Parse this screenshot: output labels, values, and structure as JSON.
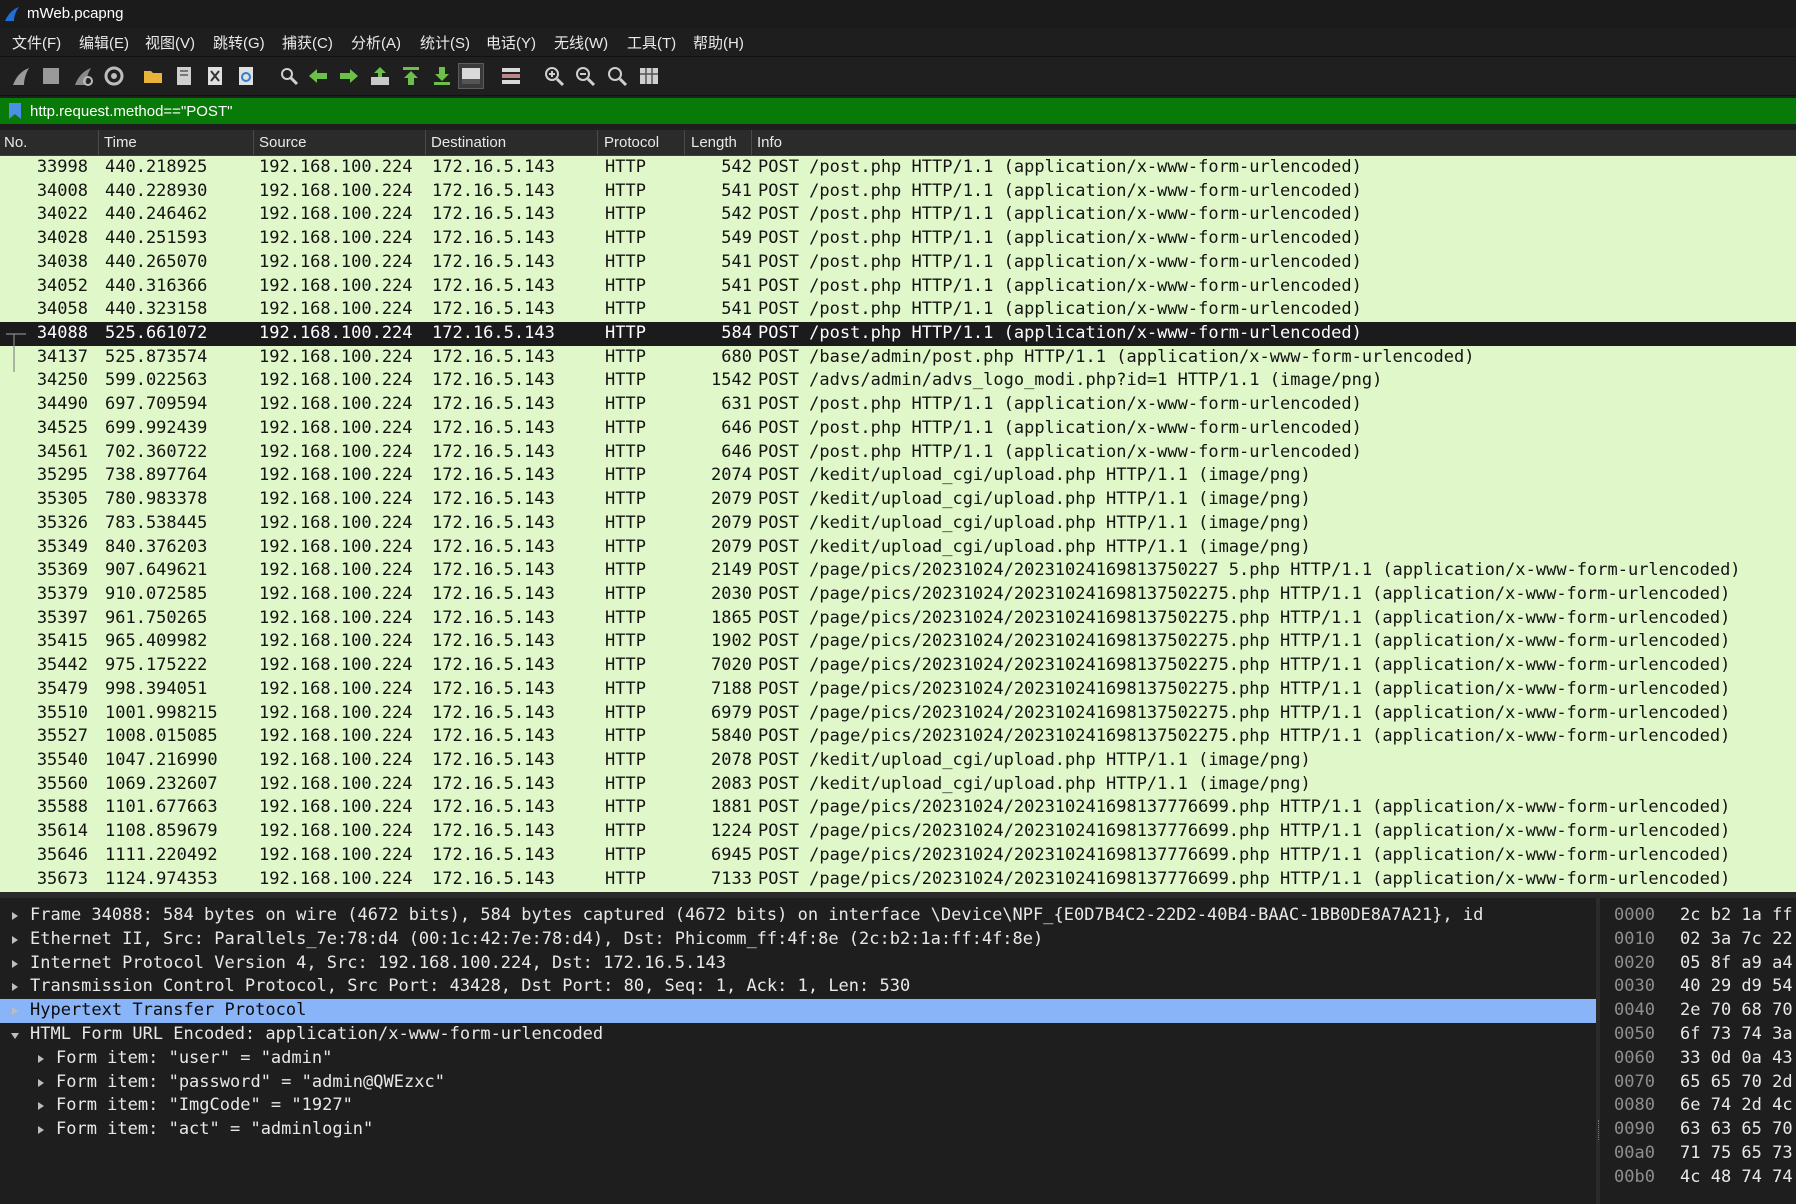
{
  "window": {
    "title": "mWeb.pcapng"
  },
  "menu": [
    "文件(F)",
    "编辑(E)",
    "视图(V)",
    "跳转(G)",
    "捕获(C)",
    "分析(A)",
    "统计(S)",
    "电话(Y)",
    "无线(W)",
    "工具(T)",
    "帮助(H)"
  ],
  "toolbar": [
    {
      "icon": "shark-fin-start-icon"
    },
    {
      "icon": "stop-capture-icon"
    },
    {
      "icon": "restart-capture-icon"
    },
    {
      "icon": "capture-options-icon"
    },
    {
      "icon": "open-folder-icon"
    },
    {
      "icon": "save-file-icon"
    },
    {
      "icon": "close-file-icon"
    },
    {
      "icon": "reload-file-icon"
    },
    {
      "icon": "find-packet-icon"
    },
    {
      "icon": "go-back-icon"
    },
    {
      "icon": "go-forward-icon"
    },
    {
      "icon": "go-to-packet-icon"
    },
    {
      "icon": "go-first-icon"
    },
    {
      "icon": "go-last-icon"
    },
    {
      "icon": "auto-scroll-icon"
    },
    {
      "icon": "colorize-icon"
    },
    {
      "icon": "zoom-in-icon"
    },
    {
      "icon": "zoom-out-icon"
    },
    {
      "icon": "zoom-normal-icon"
    },
    {
      "icon": "resize-columns-icon"
    }
  ],
  "filter": {
    "value": "http.request.method==\"POST\""
  },
  "columns": [
    "No.",
    "Time",
    "Source",
    "Destination",
    "Protocol",
    "Length",
    "Info"
  ],
  "packets": [
    {
      "no": "33998",
      "time": "440.218925",
      "src": "192.168.100.224",
      "dst": "172.16.5.143",
      "proto": "HTTP",
      "len": "542",
      "info": "POST /post.php HTTP/1.1  (application/x-www-form-urlencoded)"
    },
    {
      "no": "34008",
      "time": "440.228930",
      "src": "192.168.100.224",
      "dst": "172.16.5.143",
      "proto": "HTTP",
      "len": "541",
      "info": "POST /post.php HTTP/1.1  (application/x-www-form-urlencoded)"
    },
    {
      "no": "34022",
      "time": "440.246462",
      "src": "192.168.100.224",
      "dst": "172.16.5.143",
      "proto": "HTTP",
      "len": "542",
      "info": "POST /post.php HTTP/1.1  (application/x-www-form-urlencoded)"
    },
    {
      "no": "34028",
      "time": "440.251593",
      "src": "192.168.100.224",
      "dst": "172.16.5.143",
      "proto": "HTTP",
      "len": "549",
      "info": "POST /post.php HTTP/1.1  (application/x-www-form-urlencoded)"
    },
    {
      "no": "34038",
      "time": "440.265070",
      "src": "192.168.100.224",
      "dst": "172.16.5.143",
      "proto": "HTTP",
      "len": "541",
      "info": "POST /post.php HTTP/1.1  (application/x-www-form-urlencoded)"
    },
    {
      "no": "34052",
      "time": "440.316366",
      "src": "192.168.100.224",
      "dst": "172.16.5.143",
      "proto": "HTTP",
      "len": "541",
      "info": "POST /post.php HTTP/1.1  (application/x-www-form-urlencoded)"
    },
    {
      "no": "34058",
      "time": "440.323158",
      "src": "192.168.100.224",
      "dst": "172.16.5.143",
      "proto": "HTTP",
      "len": "541",
      "info": "POST /post.php HTTP/1.1  (application/x-www-form-urlencoded)"
    },
    {
      "no": "34088",
      "time": "525.661072",
      "src": "192.168.100.224",
      "dst": "172.16.5.143",
      "proto": "HTTP",
      "len": "584",
      "info": "POST /post.php HTTP/1.1  (application/x-www-form-urlencoded)",
      "selected": true
    },
    {
      "no": "34137",
      "time": "525.873574",
      "src": "192.168.100.224",
      "dst": "172.16.5.143",
      "proto": "HTTP",
      "len": "680",
      "info": "POST /base/admin/post.php HTTP/1.1  (application/x-www-form-urlencoded)"
    },
    {
      "no": "34250",
      "time": "599.022563",
      "src": "192.168.100.224",
      "dst": "172.16.5.143",
      "proto": "HTTP",
      "len": "1542",
      "info": "POST /advs/admin/advs_logo_modi.php?id=1 HTTP/1.1  (image/png)"
    },
    {
      "no": "34490",
      "time": "697.709594",
      "src": "192.168.100.224",
      "dst": "172.16.5.143",
      "proto": "HTTP",
      "len": "631",
      "info": "POST /post.php HTTP/1.1  (application/x-www-form-urlencoded)"
    },
    {
      "no": "34525",
      "time": "699.992439",
      "src": "192.168.100.224",
      "dst": "172.16.5.143",
      "proto": "HTTP",
      "len": "646",
      "info": "POST /post.php HTTP/1.1  (application/x-www-form-urlencoded)"
    },
    {
      "no": "34561",
      "time": "702.360722",
      "src": "192.168.100.224",
      "dst": "172.16.5.143",
      "proto": "HTTP",
      "len": "646",
      "info": "POST /post.php HTTP/1.1  (application/x-www-form-urlencoded)"
    },
    {
      "no": "35295",
      "time": "738.897764",
      "src": "192.168.100.224",
      "dst": "172.16.5.143",
      "proto": "HTTP",
      "len": "2074",
      "info": "POST /kedit/upload_cgi/upload.php HTTP/1.1  (image/png)"
    },
    {
      "no": "35305",
      "time": "780.983378",
      "src": "192.168.100.224",
      "dst": "172.16.5.143",
      "proto": "HTTP",
      "len": "2079",
      "info": "POST /kedit/upload_cgi/upload.php HTTP/1.1  (image/png)"
    },
    {
      "no": "35326",
      "time": "783.538445",
      "src": "192.168.100.224",
      "dst": "172.16.5.143",
      "proto": "HTTP",
      "len": "2079",
      "info": "POST /kedit/upload_cgi/upload.php HTTP/1.1  (image/png)"
    },
    {
      "no": "35349",
      "time": "840.376203",
      "src": "192.168.100.224",
      "dst": "172.16.5.143",
      "proto": "HTTP",
      "len": "2079",
      "info": "POST /kedit/upload_cgi/upload.php HTTP/1.1  (image/png)"
    },
    {
      "no": "35369",
      "time": "907.649621",
      "src": "192.168.100.224",
      "dst": "172.16.5.143",
      "proto": "HTTP",
      "len": "2149",
      "info": "POST /page/pics/20231024/20231024169813750227 5.php HTTP/1.1  (application/x-www-form-urlencoded)"
    },
    {
      "no": "35379",
      "time": "910.072585",
      "src": "192.168.100.224",
      "dst": "172.16.5.143",
      "proto": "HTTP",
      "len": "2030",
      "info": "POST /page/pics/20231024/202310241698137502275.php HTTP/1.1  (application/x-www-form-urlencoded)"
    },
    {
      "no": "35397",
      "time": "961.750265",
      "src": "192.168.100.224",
      "dst": "172.16.5.143",
      "proto": "HTTP",
      "len": "1865",
      "info": "POST /page/pics/20231024/202310241698137502275.php HTTP/1.1  (application/x-www-form-urlencoded)"
    },
    {
      "no": "35415",
      "time": "965.409982",
      "src": "192.168.100.224",
      "dst": "172.16.5.143",
      "proto": "HTTP",
      "len": "1902",
      "info": "POST /page/pics/20231024/202310241698137502275.php HTTP/1.1  (application/x-www-form-urlencoded)"
    },
    {
      "no": "35442",
      "time": "975.175222",
      "src": "192.168.100.224",
      "dst": "172.16.5.143",
      "proto": "HTTP",
      "len": "7020",
      "info": "POST /page/pics/20231024/202310241698137502275.php HTTP/1.1  (application/x-www-form-urlencoded)"
    },
    {
      "no": "35479",
      "time": "998.394051",
      "src": "192.168.100.224",
      "dst": "172.16.5.143",
      "proto": "HTTP",
      "len": "7188",
      "info": "POST /page/pics/20231024/202310241698137502275.php HTTP/1.1  (application/x-www-form-urlencoded)"
    },
    {
      "no": "35510",
      "time": "1001.998215",
      "src": "192.168.100.224",
      "dst": "172.16.5.143",
      "proto": "HTTP",
      "len": "6979",
      "info": "POST /page/pics/20231024/202310241698137502275.php HTTP/1.1  (application/x-www-form-urlencoded)"
    },
    {
      "no": "35527",
      "time": "1008.015085",
      "src": "192.168.100.224",
      "dst": "172.16.5.143",
      "proto": "HTTP",
      "len": "5840",
      "info": "POST /page/pics/20231024/202310241698137502275.php HTTP/1.1  (application/x-www-form-urlencoded)"
    },
    {
      "no": "35540",
      "time": "1047.216990",
      "src": "192.168.100.224",
      "dst": "172.16.5.143",
      "proto": "HTTP",
      "len": "2078",
      "info": "POST /kedit/upload_cgi/upload.php HTTP/1.1  (image/png)"
    },
    {
      "no": "35560",
      "time": "1069.232607",
      "src": "192.168.100.224",
      "dst": "172.16.5.143",
      "proto": "HTTP",
      "len": "2083",
      "info": "POST /kedit/upload_cgi/upload.php HTTP/1.1  (image/png)"
    },
    {
      "no": "35588",
      "time": "1101.677663",
      "src": "192.168.100.224",
      "dst": "172.16.5.143",
      "proto": "HTTP",
      "len": "1881",
      "info": "POST /page/pics/20231024/202310241698137776699.php HTTP/1.1  (application/x-www-form-urlencoded)"
    },
    {
      "no": "35614",
      "time": "1108.859679",
      "src": "192.168.100.224",
      "dst": "172.16.5.143",
      "proto": "HTTP",
      "len": "1224",
      "info": "POST /page/pics/20231024/202310241698137776699.php HTTP/1.1  (application/x-www-form-urlencoded)"
    },
    {
      "no": "35646",
      "time": "1111.220492",
      "src": "192.168.100.224",
      "dst": "172.16.5.143",
      "proto": "HTTP",
      "len": "6945",
      "info": "POST /page/pics/20231024/202310241698137776699.php HTTP/1.1  (application/x-www-form-urlencoded)"
    },
    {
      "no": "35673",
      "time": "1124.974353",
      "src": "192.168.100.224",
      "dst": "172.16.5.143",
      "proto": "HTTP",
      "len": "7133",
      "info": "POST /page/pics/20231024/202310241698137776699.php HTTP/1.1  (application/x-www-form-urlencoded)"
    }
  ],
  "details": [
    {
      "text": "Frame 34088: 584 bytes on wire (4672 bits), 584 bytes captured (4672 bits) on interface \\Device\\NPF_{E0D7B4C2-22D2-40B4-BAAC-1BB0DE8A7A21}, id",
      "indent": 0,
      "state": "collapsed"
    },
    {
      "text": "Ethernet II, Src: Parallels_7e:78:d4 (00:1c:42:7e:78:d4), Dst: Phicomm_ff:4f:8e (2c:b2:1a:ff:4f:8e)",
      "indent": 0,
      "state": "collapsed"
    },
    {
      "text": "Internet Protocol Version 4, Src: 192.168.100.224, Dst: 172.16.5.143",
      "indent": 0,
      "state": "collapsed"
    },
    {
      "text": "Transmission Control Protocol, Src Port: 43428, Dst Port: 80, Seq: 1, Ack: 1, Len: 530",
      "indent": 0,
      "state": "collapsed"
    },
    {
      "text": "Hypertext Transfer Protocol",
      "indent": 0,
      "state": "collapsed",
      "selected": true
    },
    {
      "text": "HTML Form URL Encoded: application/x-www-form-urlencoded",
      "indent": 0,
      "state": "expanded"
    },
    {
      "text": "Form item: \"user\" = \"admin\"",
      "indent": 1,
      "state": "collapsed"
    },
    {
      "text": "Form item: \"password\" = \"admin@QWEzxc\"",
      "indent": 1,
      "state": "collapsed"
    },
    {
      "text": "Form item: \"ImgCode\" = \"1927\"",
      "indent": 1,
      "state": "collapsed"
    },
    {
      "text": "Form item: \"act\" = \"adminlogin\"",
      "indent": 1,
      "state": "collapsed"
    }
  ],
  "bytes": [
    {
      "offset": "0000",
      "hex": "2c b2 1a ff"
    },
    {
      "offset": "0010",
      "hex": "02 3a 7c 22"
    },
    {
      "offset": "0020",
      "hex": "05 8f a9 a4"
    },
    {
      "offset": "0030",
      "hex": "40 29 d9 54"
    },
    {
      "offset": "0040",
      "hex": "2e 70 68 70"
    },
    {
      "offset": "0050",
      "hex": "6f 73 74 3a"
    },
    {
      "offset": "0060",
      "hex": "33 0d 0a 43"
    },
    {
      "offset": "0070",
      "hex": "65 65 70 2d"
    },
    {
      "offset": "0080",
      "hex": "6e 74 2d 4c"
    },
    {
      "offset": "0090",
      "hex": "63 63 65 70"
    },
    {
      "offset": "00a0",
      "hex": "71 75 65 73"
    },
    {
      "offset": "00b0",
      "hex": "4c 48 74 74"
    }
  ],
  "colors": {
    "filter_valid": "#087a08",
    "row_http": "#dff7c9",
    "row_selected": "#1b1b1b",
    "detail_selected": "#8ab4f8"
  }
}
